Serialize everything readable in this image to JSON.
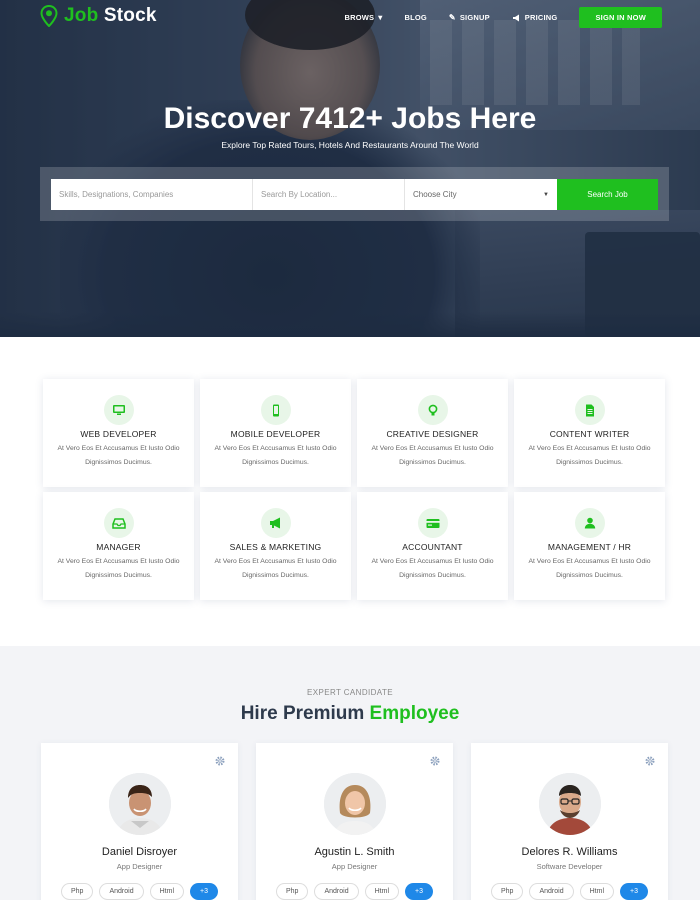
{
  "brand": {
    "name_part1": "Job",
    "name_part2": "Stock"
  },
  "nav": {
    "items": [
      {
        "label": "BROWS",
        "icon": "caret-down-icon"
      },
      {
        "label": "BLOG"
      },
      {
        "label": "SIGNUP",
        "icon": "pencil-icon"
      },
      {
        "label": "PRICING",
        "icon": "megaphone-icon"
      }
    ],
    "signin_label": "SIGN IN NOW"
  },
  "hero": {
    "title": "Discover 7412+ Jobs Here",
    "subtitle": "Explore Top Rated Tours, Hotels And Restaurants Around The World"
  },
  "search": {
    "keyword_placeholder": "Skills, Designations, Companies",
    "location_placeholder": "Search By Location...",
    "city_selected": "Choose City",
    "button_label": "Search Job"
  },
  "categories": [
    {
      "title": "WEB DEVELOPER",
      "icon": "monitor-icon",
      "desc1": "At Vero Eos Et Accusamus Et Iusto Odio",
      "desc2": "Dignissimos Ducimus."
    },
    {
      "title": "MOBILE DEVELOPER",
      "icon": "mobile-icon",
      "desc1": "At Vero Eos Et Accusamus Et Iusto Odio",
      "desc2": "Dignissimos Ducimus."
    },
    {
      "title": "CREATIVE DESIGNER",
      "icon": "lightbulb-icon",
      "desc1": "At Vero Eos Et Accusamus Et Iusto Odio",
      "desc2": "Dignissimos Ducimus."
    },
    {
      "title": "CONTENT WRITER",
      "icon": "document-icon",
      "desc1": "At Vero Eos Et Accusamus Et Iusto Odio",
      "desc2": "Dignissimos Ducimus."
    },
    {
      "title": "MANAGER",
      "icon": "inbox-icon",
      "desc1": "At Vero Eos Et Accusamus Et Iusto Odio",
      "desc2": "Dignissimos Ducimus."
    },
    {
      "title": "SALES & MARKETING",
      "icon": "megaphone-icon",
      "desc1": "At Vero Eos Et Accusamus Et Iusto Odio",
      "desc2": "Dignissimos Ducimus."
    },
    {
      "title": "ACCOUNTANT",
      "icon": "credit-card-icon",
      "desc1": "At Vero Eos Et Accusamus Et Iusto Odio",
      "desc2": "Dignissimos Ducimus."
    },
    {
      "title": "MANAGEMENT / HR",
      "icon": "user-icon",
      "desc1": "At Vero Eos Et Accusamus Et Iusto Odio",
      "desc2": "Dignissimos Ducimus."
    }
  ],
  "candidates_section": {
    "eyebrow": "EXPERT CANDIDATE",
    "title_part1": "Hire Premium",
    "title_part2": "Employee"
  },
  "candidates": [
    {
      "name": "Daniel Disroyer",
      "role": "App Designer",
      "tags": [
        "Php",
        "Android",
        "Html",
        "+3"
      ]
    },
    {
      "name": "Agustin L. Smith",
      "role": "App Designer",
      "tags": [
        "Php",
        "Android",
        "Html",
        "+3"
      ]
    },
    {
      "name": "Delores R. Williams",
      "role": "Software Developer",
      "tags": [
        "Php",
        "Android",
        "Html",
        "+3"
      ]
    }
  ],
  "colors": {
    "accent": "#1fbf1f",
    "tag_more": "#1f88e8",
    "title_dark": "#2e3a4c"
  }
}
